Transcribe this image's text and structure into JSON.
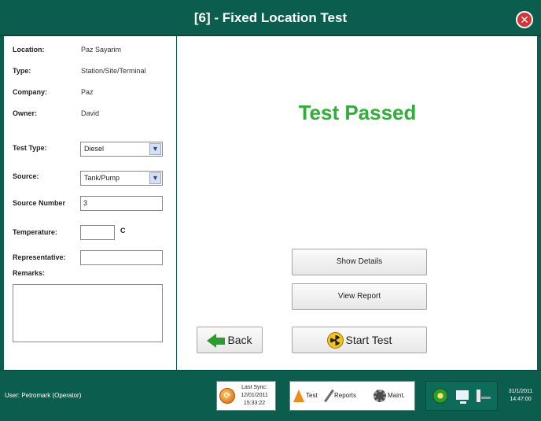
{
  "window": {
    "title": "[6] - Fixed Location Test",
    "close_glyph": "✕"
  },
  "info": {
    "location_label": "Location:",
    "location_value": "Paz Sayarim",
    "type_label": "Type:",
    "type_value": "Station/Site/Terminal",
    "company_label": "Company:",
    "company_value": "Paz",
    "owner_label": "Owner:",
    "owner_value": "David"
  },
  "form": {
    "test_type_label": "Test Type:",
    "test_type_value": "Diesel",
    "source_label": "Source:",
    "source_value": "Tank/Pump",
    "source_number_label": "Source Number",
    "source_number_value": "3",
    "temperature_label": "Temperature:",
    "temperature_value": "",
    "temperature_unit": "C",
    "representative_label": "Representative:",
    "representative_value": "",
    "remarks_label": "Remarks:",
    "remarks_value": ""
  },
  "main": {
    "status_text": "Test Passed",
    "status_color": "#2fae38",
    "show_details_label": "Show Details",
    "view_report_label": "View Report",
    "back_label": "Back",
    "start_test_label": "Start Test"
  },
  "statusbar": {
    "user_text": "User: Petromark (Operator)",
    "sync_line1": "Last Sync:",
    "sync_line2": "12/01/2011",
    "sync_line3": "15:33:22",
    "test_label": "Test",
    "reports_label": "Reports",
    "maint_label": "Maint.",
    "date": "31/1/2011",
    "time": "14:47:00"
  },
  "icons": [
    "close-icon",
    "dropdown-arrow-icon",
    "back-arrow-icon",
    "radiation-icon",
    "sync-icon",
    "flask-icon",
    "pen-icon",
    "gear-icon",
    "signal-icon",
    "computer-icon",
    "usb-icon"
  ],
  "colors": {
    "chrome": "#0b5e4e",
    "accent_green": "#2fae38",
    "close_red": "#d63333"
  }
}
